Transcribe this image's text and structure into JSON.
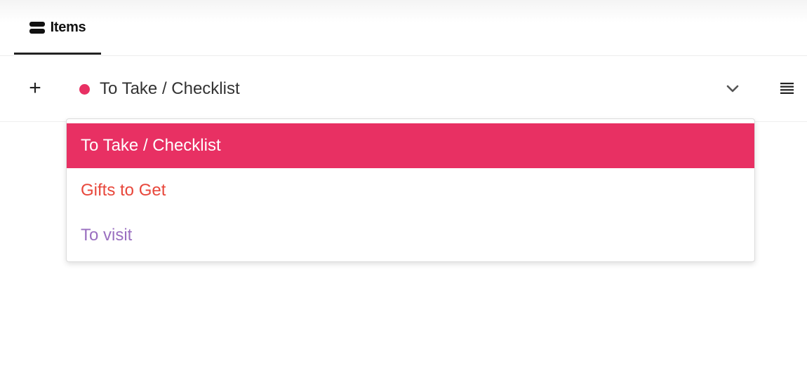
{
  "tabs": [
    {
      "label": "Items",
      "icon": "items-icon",
      "active": true
    }
  ],
  "toolbar": {
    "add_label": "+",
    "current_list": {
      "label": "To Take / Checklist",
      "color": "#e83063"
    }
  },
  "dropdown": {
    "options": [
      {
        "label": "To Take / Checklist",
        "color": "#e83063",
        "selected": true
      },
      {
        "label": "Gifts to Get",
        "color": "#e8473b",
        "selected": false
      },
      {
        "label": "To visit",
        "color": "#9a6fc0",
        "selected": false
      }
    ]
  }
}
